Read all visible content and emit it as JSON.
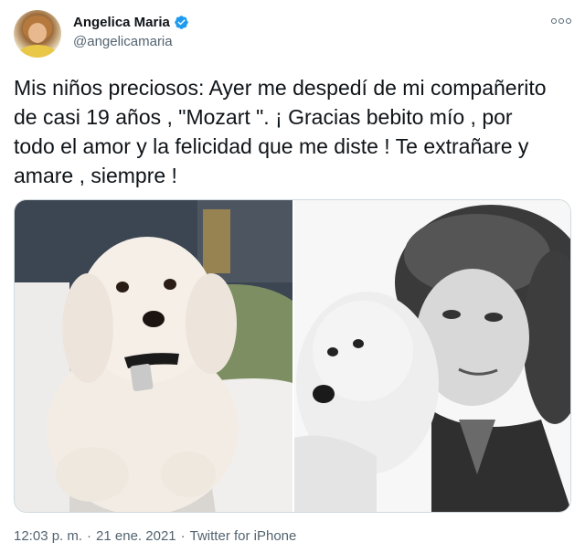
{
  "author": {
    "display_name": "Angelica Maria",
    "handle": "@angelicamaria",
    "verified": true,
    "avatar_icon": "profile-photo"
  },
  "tweet": {
    "text": "Mis niños preciosos: Ayer me despedí de mi compañerito\nde casi 19 años , \"Mozart \". ¡ Gracias  bebito  mío , por\ntodo el amor y la felicidad que me diste ! Te extrañare y\namare , siempre !"
  },
  "media": {
    "images": [
      {
        "description_icon": "dog-photo"
      },
      {
        "description_icon": "sketch-portrait-photo"
      }
    ]
  },
  "meta": {
    "time": "12:03 p. m.",
    "separator1": "·",
    "date": "21 ene. 2021",
    "separator2": "·",
    "source": "Twitter for iPhone"
  },
  "colors": {
    "text": "#0f1419",
    "secondary": "#536471",
    "verified": "#1d9bf0",
    "border": "#cfd9de"
  }
}
